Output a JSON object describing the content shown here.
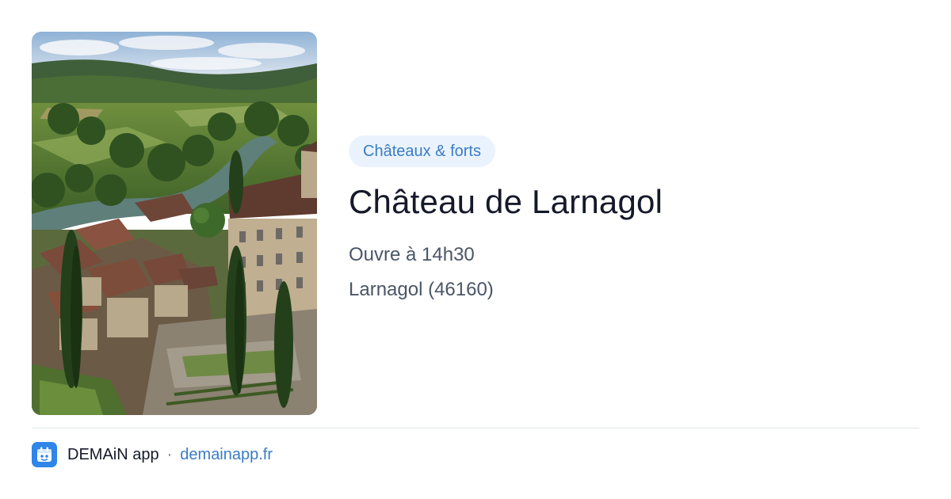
{
  "card": {
    "image_alt": "Aerial view of the château and village above the river valley",
    "category": "Châteaux & forts",
    "title": "Château de Larnagol",
    "hours": "Ouvre à 14h30",
    "location": "Larnagol (46160)"
  },
  "footer": {
    "app_name": "DEMAiN app",
    "separator": "·",
    "domain": "demainapp.fr",
    "icon": "calendar-app-icon"
  },
  "colors": {
    "badge_bg": "#eaf3fd",
    "badge_text": "#3a7cc4",
    "title": "#15192a",
    "meta": "#4a5566",
    "link": "#3a7cc4",
    "app_icon": "#2e86e8"
  }
}
